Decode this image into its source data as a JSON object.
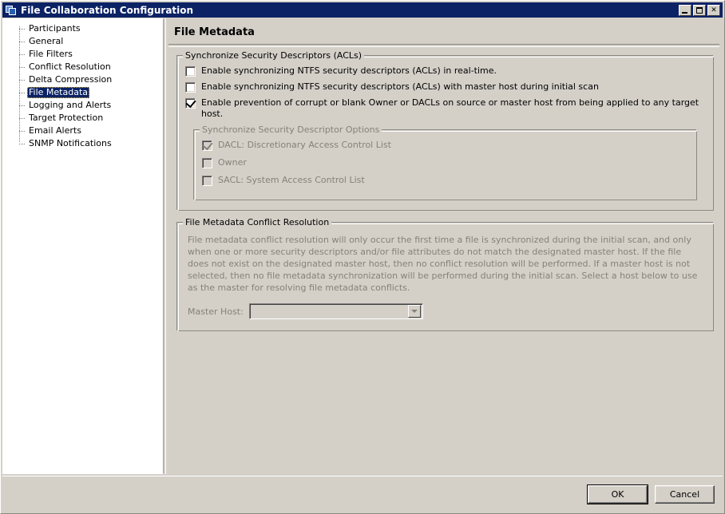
{
  "window": {
    "title": "File Collaboration Configuration",
    "icon": "app-layers-icon",
    "minimize_label": "Minimize",
    "maximize_label": "Maximize",
    "close_label": "Close",
    "close_glyph": "✕"
  },
  "sidebar": {
    "items": [
      {
        "label": "Participants",
        "selected": false
      },
      {
        "label": "General",
        "selected": false
      },
      {
        "label": "File Filters",
        "selected": false
      },
      {
        "label": "Conflict Resolution",
        "selected": false
      },
      {
        "label": "Delta Compression",
        "selected": false
      },
      {
        "label": "File Metadata",
        "selected": true
      },
      {
        "label": "Logging and Alerts",
        "selected": false
      },
      {
        "label": "Target Protection",
        "selected": false
      },
      {
        "label": "Email Alerts",
        "selected": false
      },
      {
        "label": "SNMP Notifications",
        "selected": false
      }
    ]
  },
  "main": {
    "page_title": "File Metadata",
    "acl_group": {
      "title": "Synchronize Security Descriptors (ACLs)",
      "checkboxes": [
        {
          "label": "Enable synchronizing NTFS security descriptors (ACLs) in real-time.",
          "checked": false,
          "disabled": false
        },
        {
          "label": "Enable synchronizing NTFS security descriptors (ACLs) with master host during initial scan",
          "checked": false,
          "disabled": false
        },
        {
          "label": "Enable prevention of corrupt or blank Owner or DACLs on source or master host from being applied to any target host.",
          "checked": true,
          "disabled": false
        }
      ],
      "options_group": {
        "title": "Synchronize Security Descriptor Options",
        "checkboxes": [
          {
            "label": "DACL: Discretionary Access Control List",
            "checked": true,
            "disabled": true
          },
          {
            "label": "Owner",
            "checked": false,
            "disabled": true
          },
          {
            "label": "SACL: System Access Control List",
            "checked": false,
            "disabled": true
          }
        ]
      }
    },
    "conflict_group": {
      "title": "File Metadata Conflict Resolution",
      "description": "File metadata conflict resolution will only occur the first time a file is synchronized during the initial scan, and only when one or more security descriptors and/or file attributes do not match the designated master host. If the file does not exist on the designated master host, then no conflict resolution will be performed. If a master host is not selected, then no file metadata synchronization will be performed during the initial scan. Select a host below to use as the master for resolving file metadata conflicts.",
      "master_host_label": "Master Host:",
      "master_host_value": "",
      "master_host_disabled": true
    }
  },
  "footer": {
    "ok_label": "OK",
    "cancel_label": "Cancel"
  },
  "colors": {
    "titlebar": "#0b2265",
    "face": "#d4d0c8",
    "selection": "#0b2265",
    "disabled_text": "#848278"
  }
}
